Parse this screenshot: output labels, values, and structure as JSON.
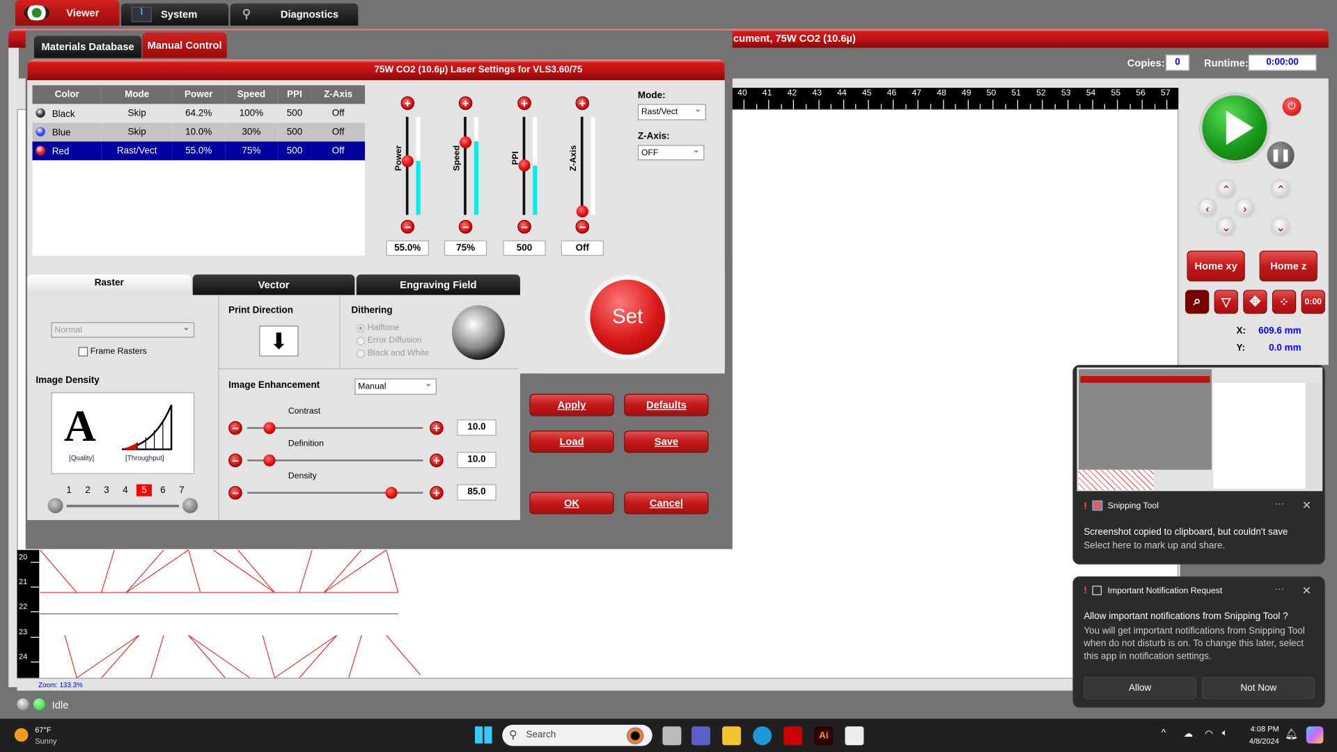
{
  "top_tabs": [
    {
      "label": "Viewer",
      "icon": "eye-icon"
    },
    {
      "label": "System",
      "icon": "heartbeat-monitor-icon"
    },
    {
      "label": "Diagnostics",
      "icon": "stethoscope-icon"
    }
  ],
  "main_title": "cument, 75W CO2 (10.6µ)",
  "copies": {
    "label": "Copies:",
    "value": "0"
  },
  "runtime": {
    "label": "Runtime:",
    "value": "0:00:00"
  },
  "ruler_top": [
    "40",
    "41",
    "42",
    "43",
    "44",
    "45",
    "46",
    "47",
    "48",
    "49",
    "50",
    "51",
    "52",
    "53",
    "54",
    "55",
    "56",
    "57"
  ],
  "ruler_left": [
    "20",
    "21",
    "22",
    "23",
    "24"
  ],
  "zoom_text": "Zoom:  133.3%",
  "status": "Idle",
  "dialog": {
    "tabs": [
      "Materials Database",
      "Manual Control"
    ],
    "header": "75W CO2 (10.6µ) Laser Settings for VLS3.60/75",
    "columns": [
      "Color",
      "Mode",
      "Power",
      "Speed",
      "PPI",
      "Z-Axis"
    ],
    "rows": [
      {
        "color": "Black",
        "swatch": "#333333",
        "mode": "Skip",
        "power": "64.2%",
        "speed": "100%",
        "ppi": "500",
        "z": "Off"
      },
      {
        "color": "Blue",
        "swatch": "#3344ff",
        "mode": "Skip",
        "power": "10.0%",
        "speed": "30%",
        "ppi": "500",
        "z": "Off"
      },
      {
        "color": "Red",
        "swatch": "#ff1111",
        "mode": "Rast/Vect",
        "power": "55.0%",
        "speed": "75%",
        "ppi": "500",
        "z": "Off",
        "selected": true
      }
    ],
    "sliders": [
      {
        "label": "Power",
        "value": "55.0%",
        "level": 0.55
      },
      {
        "label": "Speed",
        "value": "75%",
        "level": 0.75
      },
      {
        "label": "PPI",
        "value": "500",
        "level": 0.5
      },
      {
        "label": "Z-Axis",
        "value": "Off",
        "level": 0.0
      }
    ],
    "mode_label": "Mode:",
    "mode_value": "Rast/Vect",
    "zaxis_label": "Z-Axis:",
    "zaxis_value": "OFF",
    "set_label": "Set",
    "subtabs": [
      "Raster",
      "Vector",
      "Engraving Field"
    ],
    "raster_type": "Normal",
    "frame_rasters": "Frame Rasters",
    "image_density_label": "Image Density",
    "quality_label": "[Quality]",
    "throughput_label": "[Throughput]",
    "density_steps": [
      "1",
      "2",
      "3",
      "4",
      "5",
      "6",
      "7"
    ],
    "density_selected": "5",
    "print_direction_label": "Print Direction",
    "dithering_label": "Dithering",
    "dithering_options": [
      "Halftone",
      "Error Diffusion",
      "Black and White"
    ],
    "dithering_selected": "Halftone",
    "image_enhancement_label": "Image Enhancement",
    "image_enhancement_value": "Manual",
    "enhancements": [
      {
        "label": "Contrast",
        "value": "10.0",
        "level": 0.1
      },
      {
        "label": "Definition",
        "value": "10.0",
        "level": 0.1
      },
      {
        "label": "Density",
        "value": "85.0",
        "level": 0.85
      }
    ],
    "buttons": {
      "apply": "Apply",
      "defaults": "Defaults",
      "load": "Load",
      "save": "Save",
      "ok": "OK",
      "cancel": "Cancel"
    }
  },
  "control_panel": {
    "home_xy": "Home xy",
    "home_z": "Home z",
    "x_label": "X:",
    "x_value": "609.6 mm",
    "y_label": "Y:",
    "y_value": "0.0 mm"
  },
  "notifications": [
    {
      "app": "Snipping Tool",
      "title": "Screenshot copied to clipboard, but couldn't save",
      "body": "Select here to mark up and share."
    },
    {
      "app": "Important Notification Request",
      "title": "Allow important notifications from Snipping Tool ?",
      "body": "You will get important notifications from Snipping Tool when do not disturb is on. To change this later, select this app in notification settings.",
      "allow": "Allow",
      "not_now": "Not Now"
    }
  ],
  "taskbar": {
    "temp": "67°F",
    "weather": "Sunny",
    "search_placeholder": "Search",
    "time": "4:08 PM",
    "date": "4/8/2024"
  },
  "colors": {
    "accent_red": "#c01212",
    "selected_row": "#0000a0",
    "value_blue": "#0000ff"
  }
}
